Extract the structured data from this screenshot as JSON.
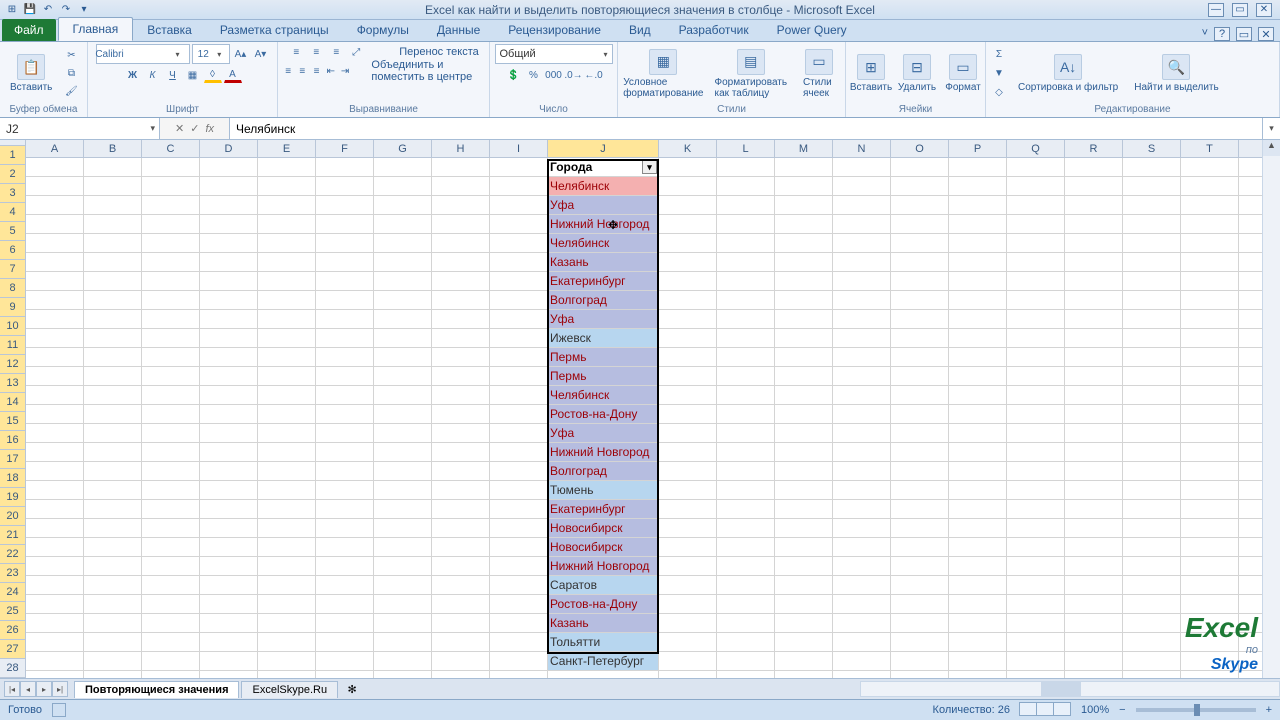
{
  "app": {
    "title": "Excel как найти и выделить повторяющиеся значения в столбце - Microsoft Excel"
  },
  "qat": {
    "save": "💾",
    "undo": "↶",
    "redo": "↷",
    "dd": "▾"
  },
  "tabs": {
    "file": "Файл",
    "items": [
      "Главная",
      "Вставка",
      "Разметка страницы",
      "Формулы",
      "Данные",
      "Рецензирование",
      "Вид",
      "Разработчик",
      "Power Query"
    ],
    "active": 0
  },
  "ribbon": {
    "clipboard": {
      "paste": "Вставить",
      "label": "Буфер обмена"
    },
    "font": {
      "name": "Calibri",
      "size": "12",
      "label": "Шрифт",
      "bold": "Ж",
      "italic": "К",
      "underline": "Ч"
    },
    "align": {
      "wrap": "Перенос текста",
      "merge": "Объединить и поместить в центре",
      "label": "Выравнивание"
    },
    "number": {
      "format": "Общий",
      "label": "Число"
    },
    "styles": {
      "cond": "Условное форматирование",
      "table": "Форматировать как таблицу",
      "cell": "Стили ячеек",
      "label": "Стили"
    },
    "cells": {
      "insert": "Вставить",
      "delete": "Удалить",
      "format": "Формат",
      "label": "Ячейки"
    },
    "editing": {
      "sort": "Сортировка и фильтр",
      "find": "Найти и выделить",
      "label": "Редактирование"
    }
  },
  "namebox": "J2",
  "formula": "Челябинск",
  "columns": [
    "A",
    "B",
    "C",
    "D",
    "E",
    "F",
    "G",
    "H",
    "I",
    "J",
    "K",
    "L",
    "M",
    "N",
    "O",
    "P",
    "Q",
    "R",
    "S",
    "T"
  ],
  "wide_col": "J",
  "active_col": "J",
  "row_count": 28,
  "header_cell": {
    "row": 1,
    "col": "J",
    "text": "Города",
    "filter": true
  },
  "data": [
    {
      "row": 2,
      "text": "Челябинск",
      "dup": true,
      "active": true
    },
    {
      "row": 3,
      "text": "Уфа",
      "dup": true
    },
    {
      "row": 4,
      "text": "Нижний Новгород",
      "dup": true
    },
    {
      "row": 5,
      "text": "Челябинск",
      "dup": true
    },
    {
      "row": 6,
      "text": "Казань",
      "dup": true
    },
    {
      "row": 7,
      "text": "Екатеринбург",
      "dup": true
    },
    {
      "row": 8,
      "text": "Волгоград",
      "dup": true
    },
    {
      "row": 9,
      "text": "Уфа",
      "dup": true
    },
    {
      "row": 10,
      "text": "Ижевск",
      "dup": false
    },
    {
      "row": 11,
      "text": "Пермь",
      "dup": true
    },
    {
      "row": 12,
      "text": "Пермь",
      "dup": true
    },
    {
      "row": 13,
      "text": "Челябинск",
      "dup": true
    },
    {
      "row": 14,
      "text": "Ростов-на-Дону",
      "dup": true
    },
    {
      "row": 15,
      "text": "Уфа",
      "dup": true
    },
    {
      "row": 16,
      "text": "Нижний Новгород",
      "dup": true
    },
    {
      "row": 17,
      "text": "Волгоград",
      "dup": true
    },
    {
      "row": 18,
      "text": "Тюмень",
      "dup": false
    },
    {
      "row": 19,
      "text": "Екатеринбург",
      "dup": true
    },
    {
      "row": 20,
      "text": "Новосибирск",
      "dup": true
    },
    {
      "row": 21,
      "text": "Новосибирск",
      "dup": true
    },
    {
      "row": 22,
      "text": "Нижний Новгород",
      "dup": true
    },
    {
      "row": 23,
      "text": "Саратов",
      "dup": false
    },
    {
      "row": 24,
      "text": "Ростов-на-Дону",
      "dup": true
    },
    {
      "row": 25,
      "text": "Казань",
      "dup": true
    },
    {
      "row": 26,
      "text": "Тольятти",
      "dup": false
    },
    {
      "row": 27,
      "text": "Санкт-Петербург",
      "dup": false
    }
  ],
  "sheets": {
    "items": [
      "Повторяющиеся значения",
      "ExcelSkype.Ru"
    ],
    "active": 0
  },
  "status": {
    "ready": "Готово",
    "count_label": "Количество:",
    "count": "26",
    "zoom": "100%"
  },
  "watermark": {
    "brand": "Excel",
    "line1": "по",
    "line2": "Skype"
  }
}
